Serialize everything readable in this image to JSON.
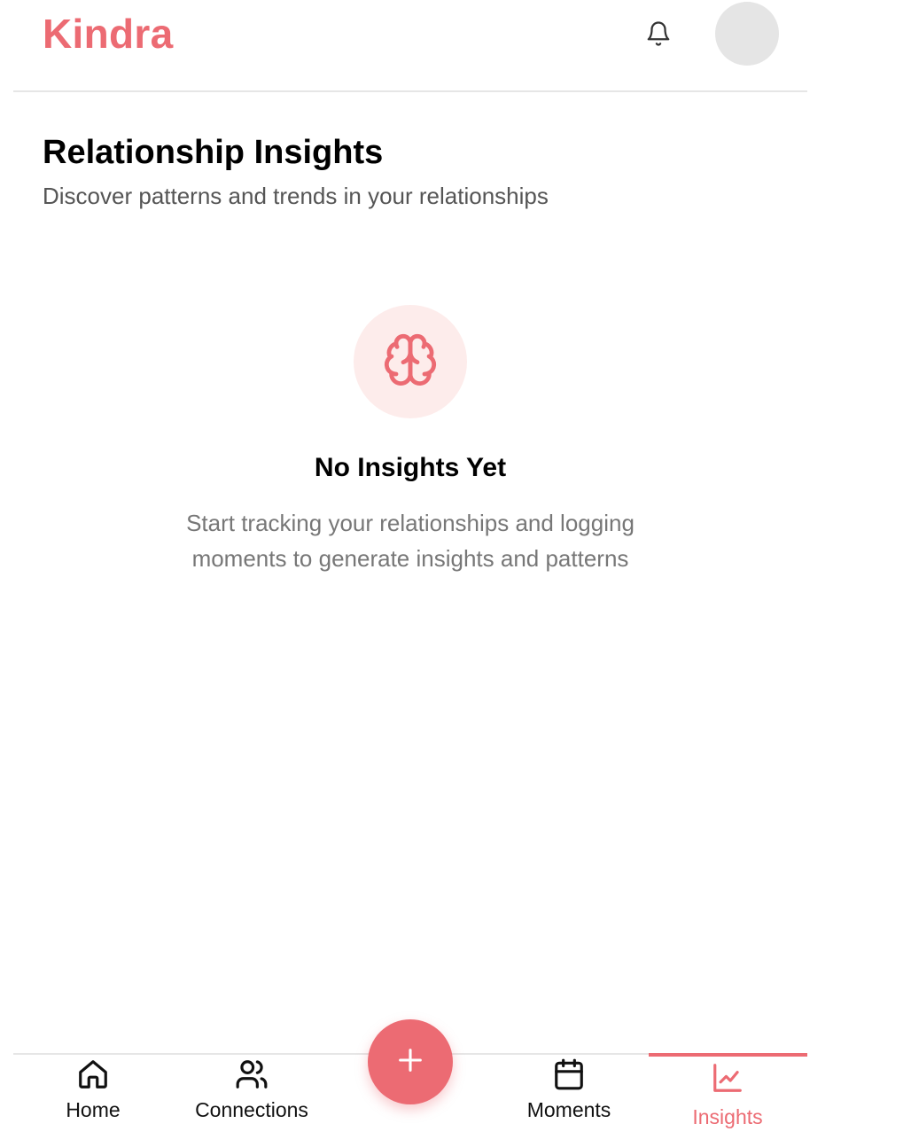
{
  "header": {
    "brand": "Kindra",
    "notification_icon": "bell-icon",
    "avatar_icon": "avatar"
  },
  "page": {
    "title": "Relationship Insights",
    "subtitle": "Discover patterns and trends in your relationships"
  },
  "empty_state": {
    "icon": "brain-icon",
    "title": "No Insights Yet",
    "description": "Start tracking your relationships and logging moments to generate insights and patterns"
  },
  "bottom_nav": {
    "items": [
      {
        "label": "Home",
        "icon": "home-icon",
        "active": false
      },
      {
        "label": "Connections",
        "icon": "users-icon",
        "active": false
      },
      {
        "label": "Moments",
        "icon": "calendar-icon",
        "active": false
      },
      {
        "label": "Insights",
        "icon": "chart-line-icon",
        "active": true
      }
    ],
    "fab_icon": "plus-icon"
  },
  "colors": {
    "accent": "#ec6b73",
    "accent_soft": "#fdeceb",
    "text_primary": "#000000",
    "text_secondary": "#555555",
    "text_muted": "#777777",
    "avatar_bg": "#e5e5e5"
  }
}
